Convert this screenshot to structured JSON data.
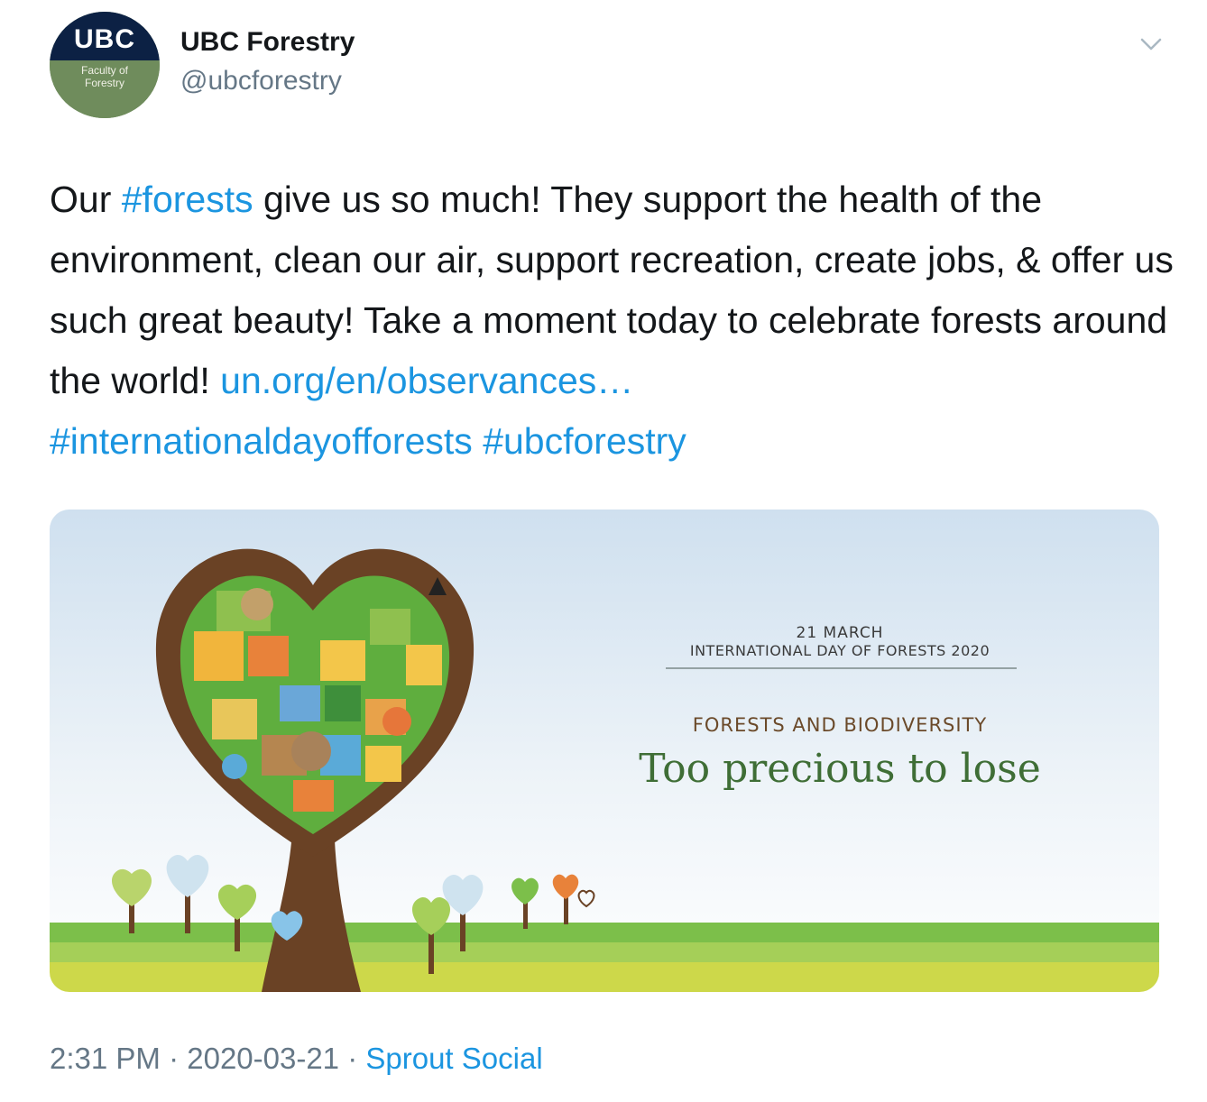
{
  "author": {
    "avatar_logo": "UBC",
    "avatar_subtitle_line1": "Faculty of",
    "avatar_subtitle_line2": "Forestry",
    "display_name": "UBC Forestry",
    "handle": "@ubcforestry"
  },
  "tweet": {
    "t1": "Our ",
    "hashtag_forests": "#forests",
    "t2": " give us so much! They support the health of the environment, clean our air, support recreation, create jobs, & offer us such great beauty! Take a moment today to celebrate forests around the world! ",
    "url": "un.org/en/observances…",
    "hashtag_intl": "#internationaldayofforests",
    "hashtag_ubc": "#ubcforestry"
  },
  "media": {
    "date": "21 MARCH",
    "event": "INTERNATIONAL DAY OF FORESTS 2020",
    "theme": "FORESTS AND BIODIVERSITY",
    "tagline": "Too precious to lose"
  },
  "meta": {
    "time": "2:31 PM",
    "separator": " · ",
    "date": "2020-03-21",
    "source": "Sprout Social"
  },
  "icons": {
    "caret": "chevron-down-icon"
  },
  "colors": {
    "link": "#1b95e0",
    "secondary_text": "#657786",
    "tagline_green": "#3f6e36"
  }
}
